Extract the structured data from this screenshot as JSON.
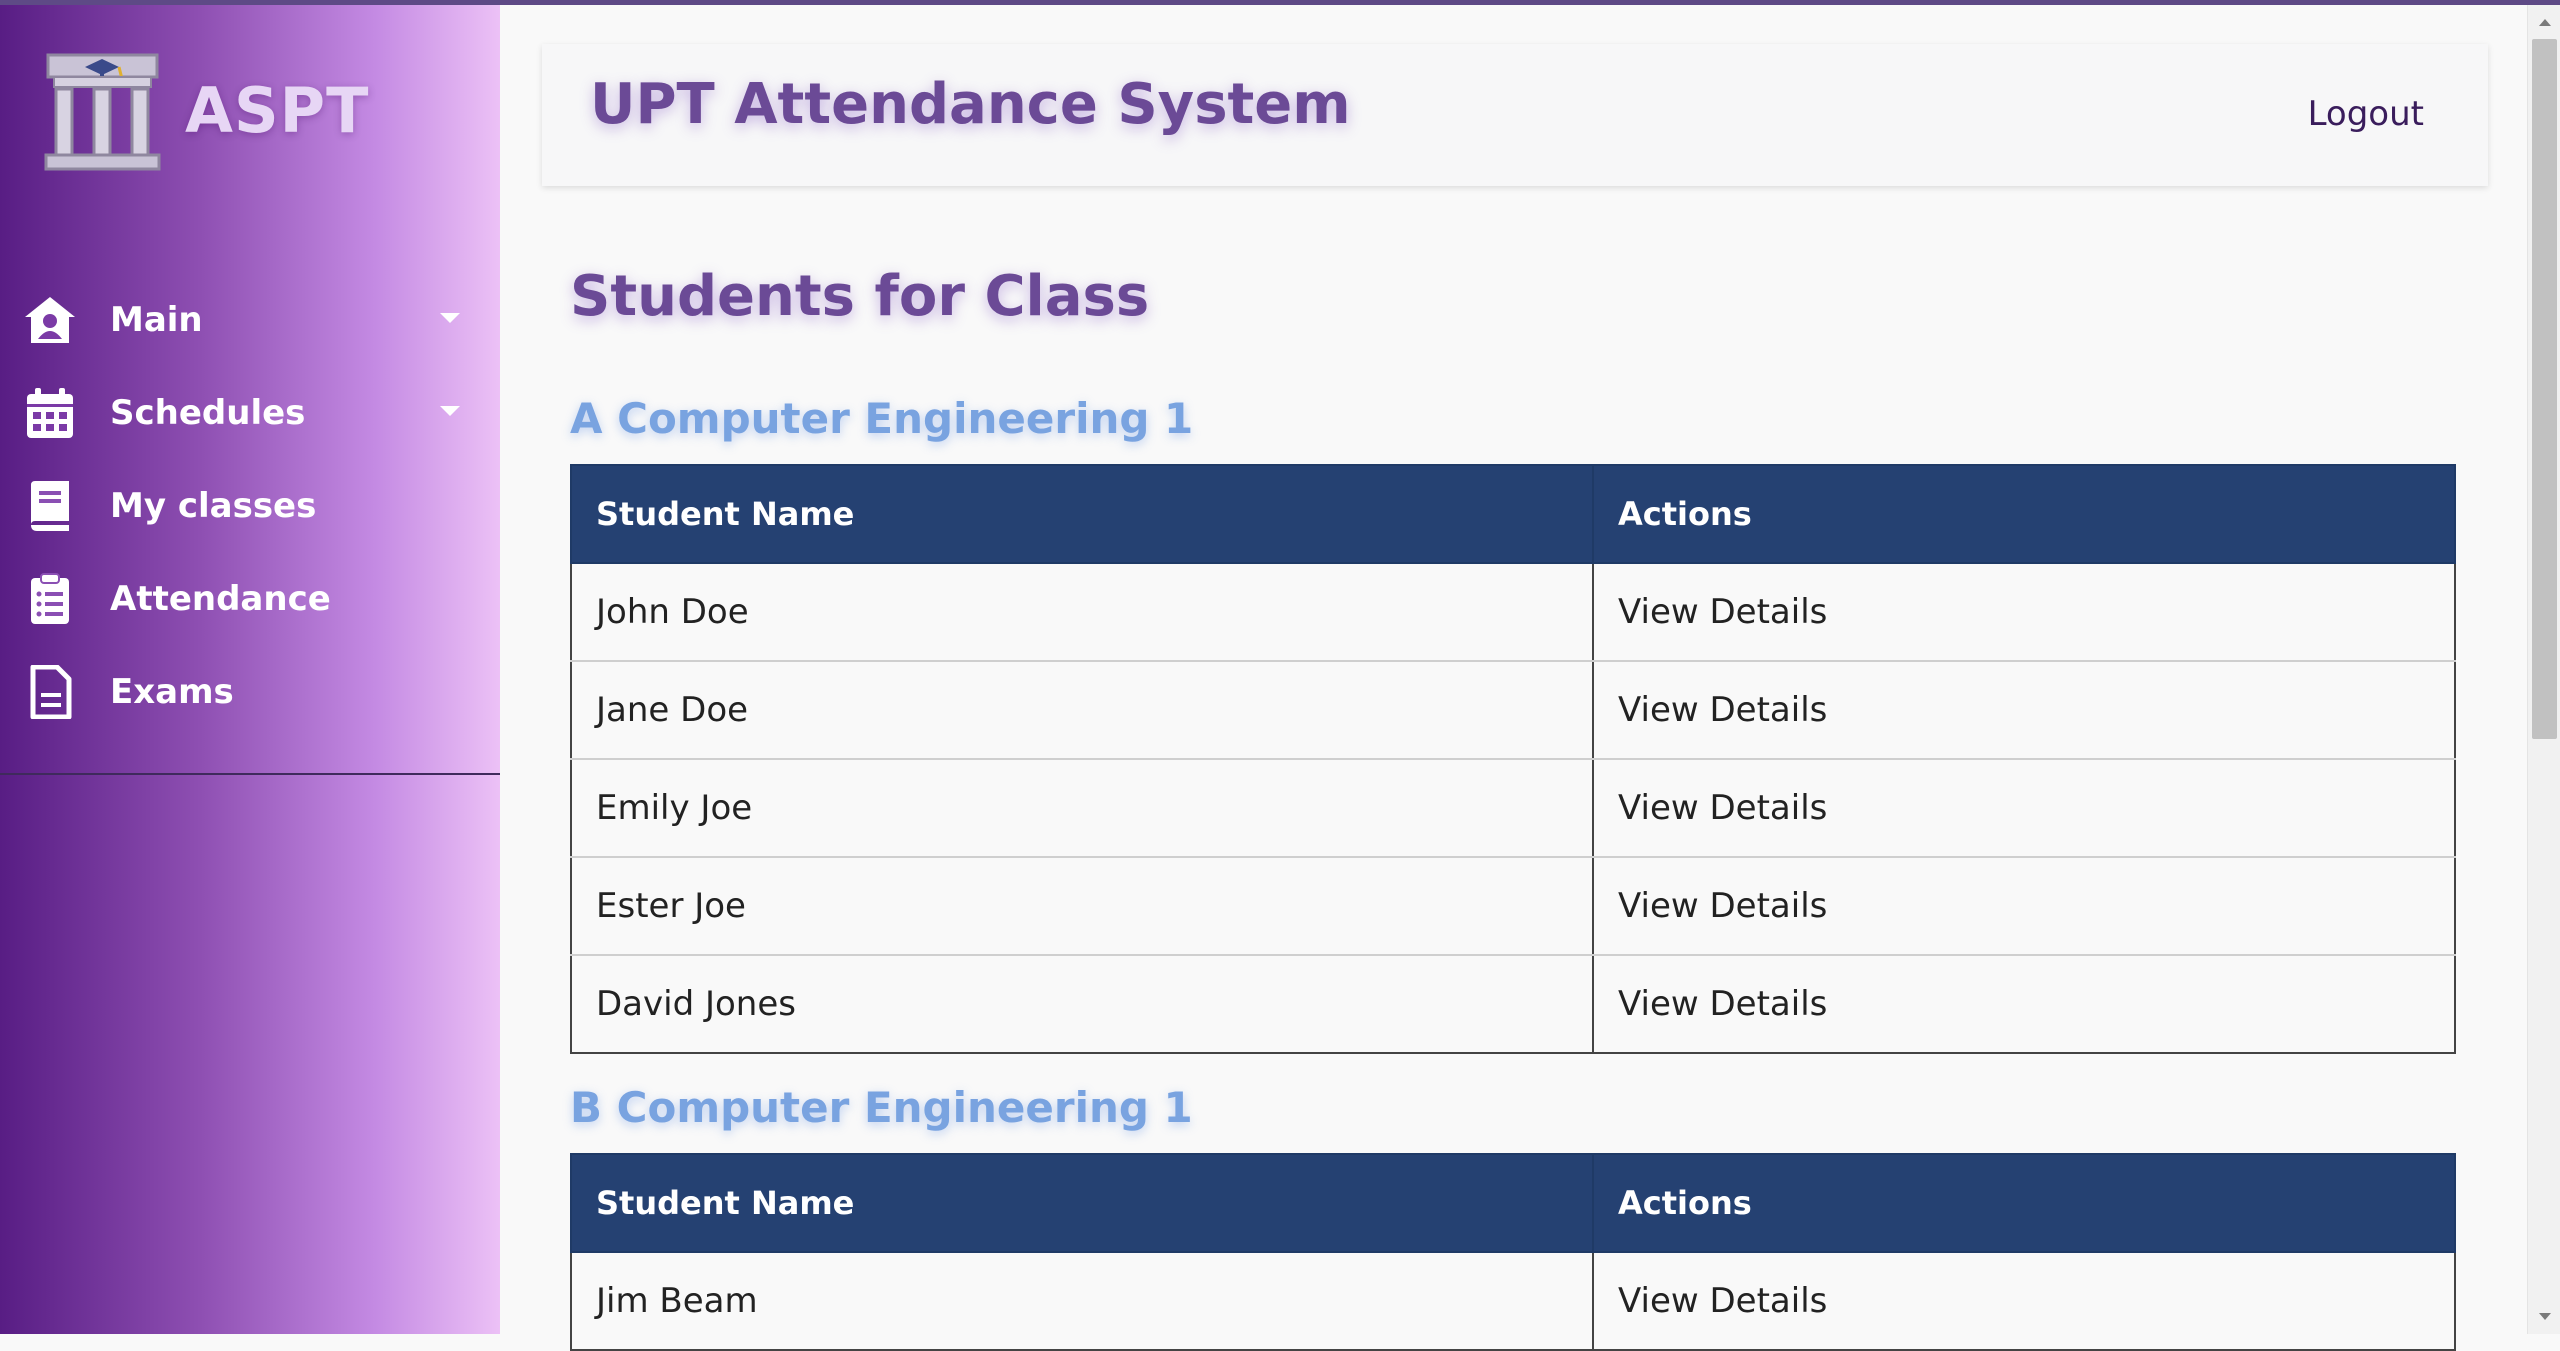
{
  "brand": {
    "name": "ASPT"
  },
  "sidebar": {
    "items": [
      {
        "label": "Main",
        "icon": "home-user-icon",
        "has_dropdown": true
      },
      {
        "label": "Schedules",
        "icon": "calendar-icon",
        "has_dropdown": true
      },
      {
        "label": "My classes",
        "icon": "book-icon",
        "has_dropdown": false
      },
      {
        "label": "Attendance",
        "icon": "clipboard-list-icon",
        "has_dropdown": false
      },
      {
        "label": "Exams",
        "icon": "document-icon",
        "has_dropdown": false
      }
    ]
  },
  "header": {
    "title": "UPT Attendance System",
    "logout_label": "Logout"
  },
  "main": {
    "page_title": "Students for Class",
    "classes": [
      {
        "name": "A Computer Engineering 1",
        "columns": [
          "Student Name",
          "Actions"
        ],
        "rows": [
          {
            "name": "John Doe",
            "action": "View Details"
          },
          {
            "name": "Jane Doe",
            "action": "View Details"
          },
          {
            "name": "Emily Joe",
            "action": "View Details"
          },
          {
            "name": "Ester Joe",
            "action": "View Details"
          },
          {
            "name": "David Jones",
            "action": "View Details"
          }
        ]
      },
      {
        "name": "B Computer Engineering 1",
        "columns": [
          "Student Name",
          "Actions"
        ],
        "rows": [
          {
            "name": "Jim Beam",
            "action": "View Details"
          }
        ]
      }
    ]
  },
  "colors": {
    "sidebar_gradient_start": "#581d84",
    "sidebar_gradient_end": "#ecc1f6",
    "title_purple": "#6b4a96",
    "class_title_blue": "#79a3e0",
    "table_header_navy": "#254172"
  }
}
